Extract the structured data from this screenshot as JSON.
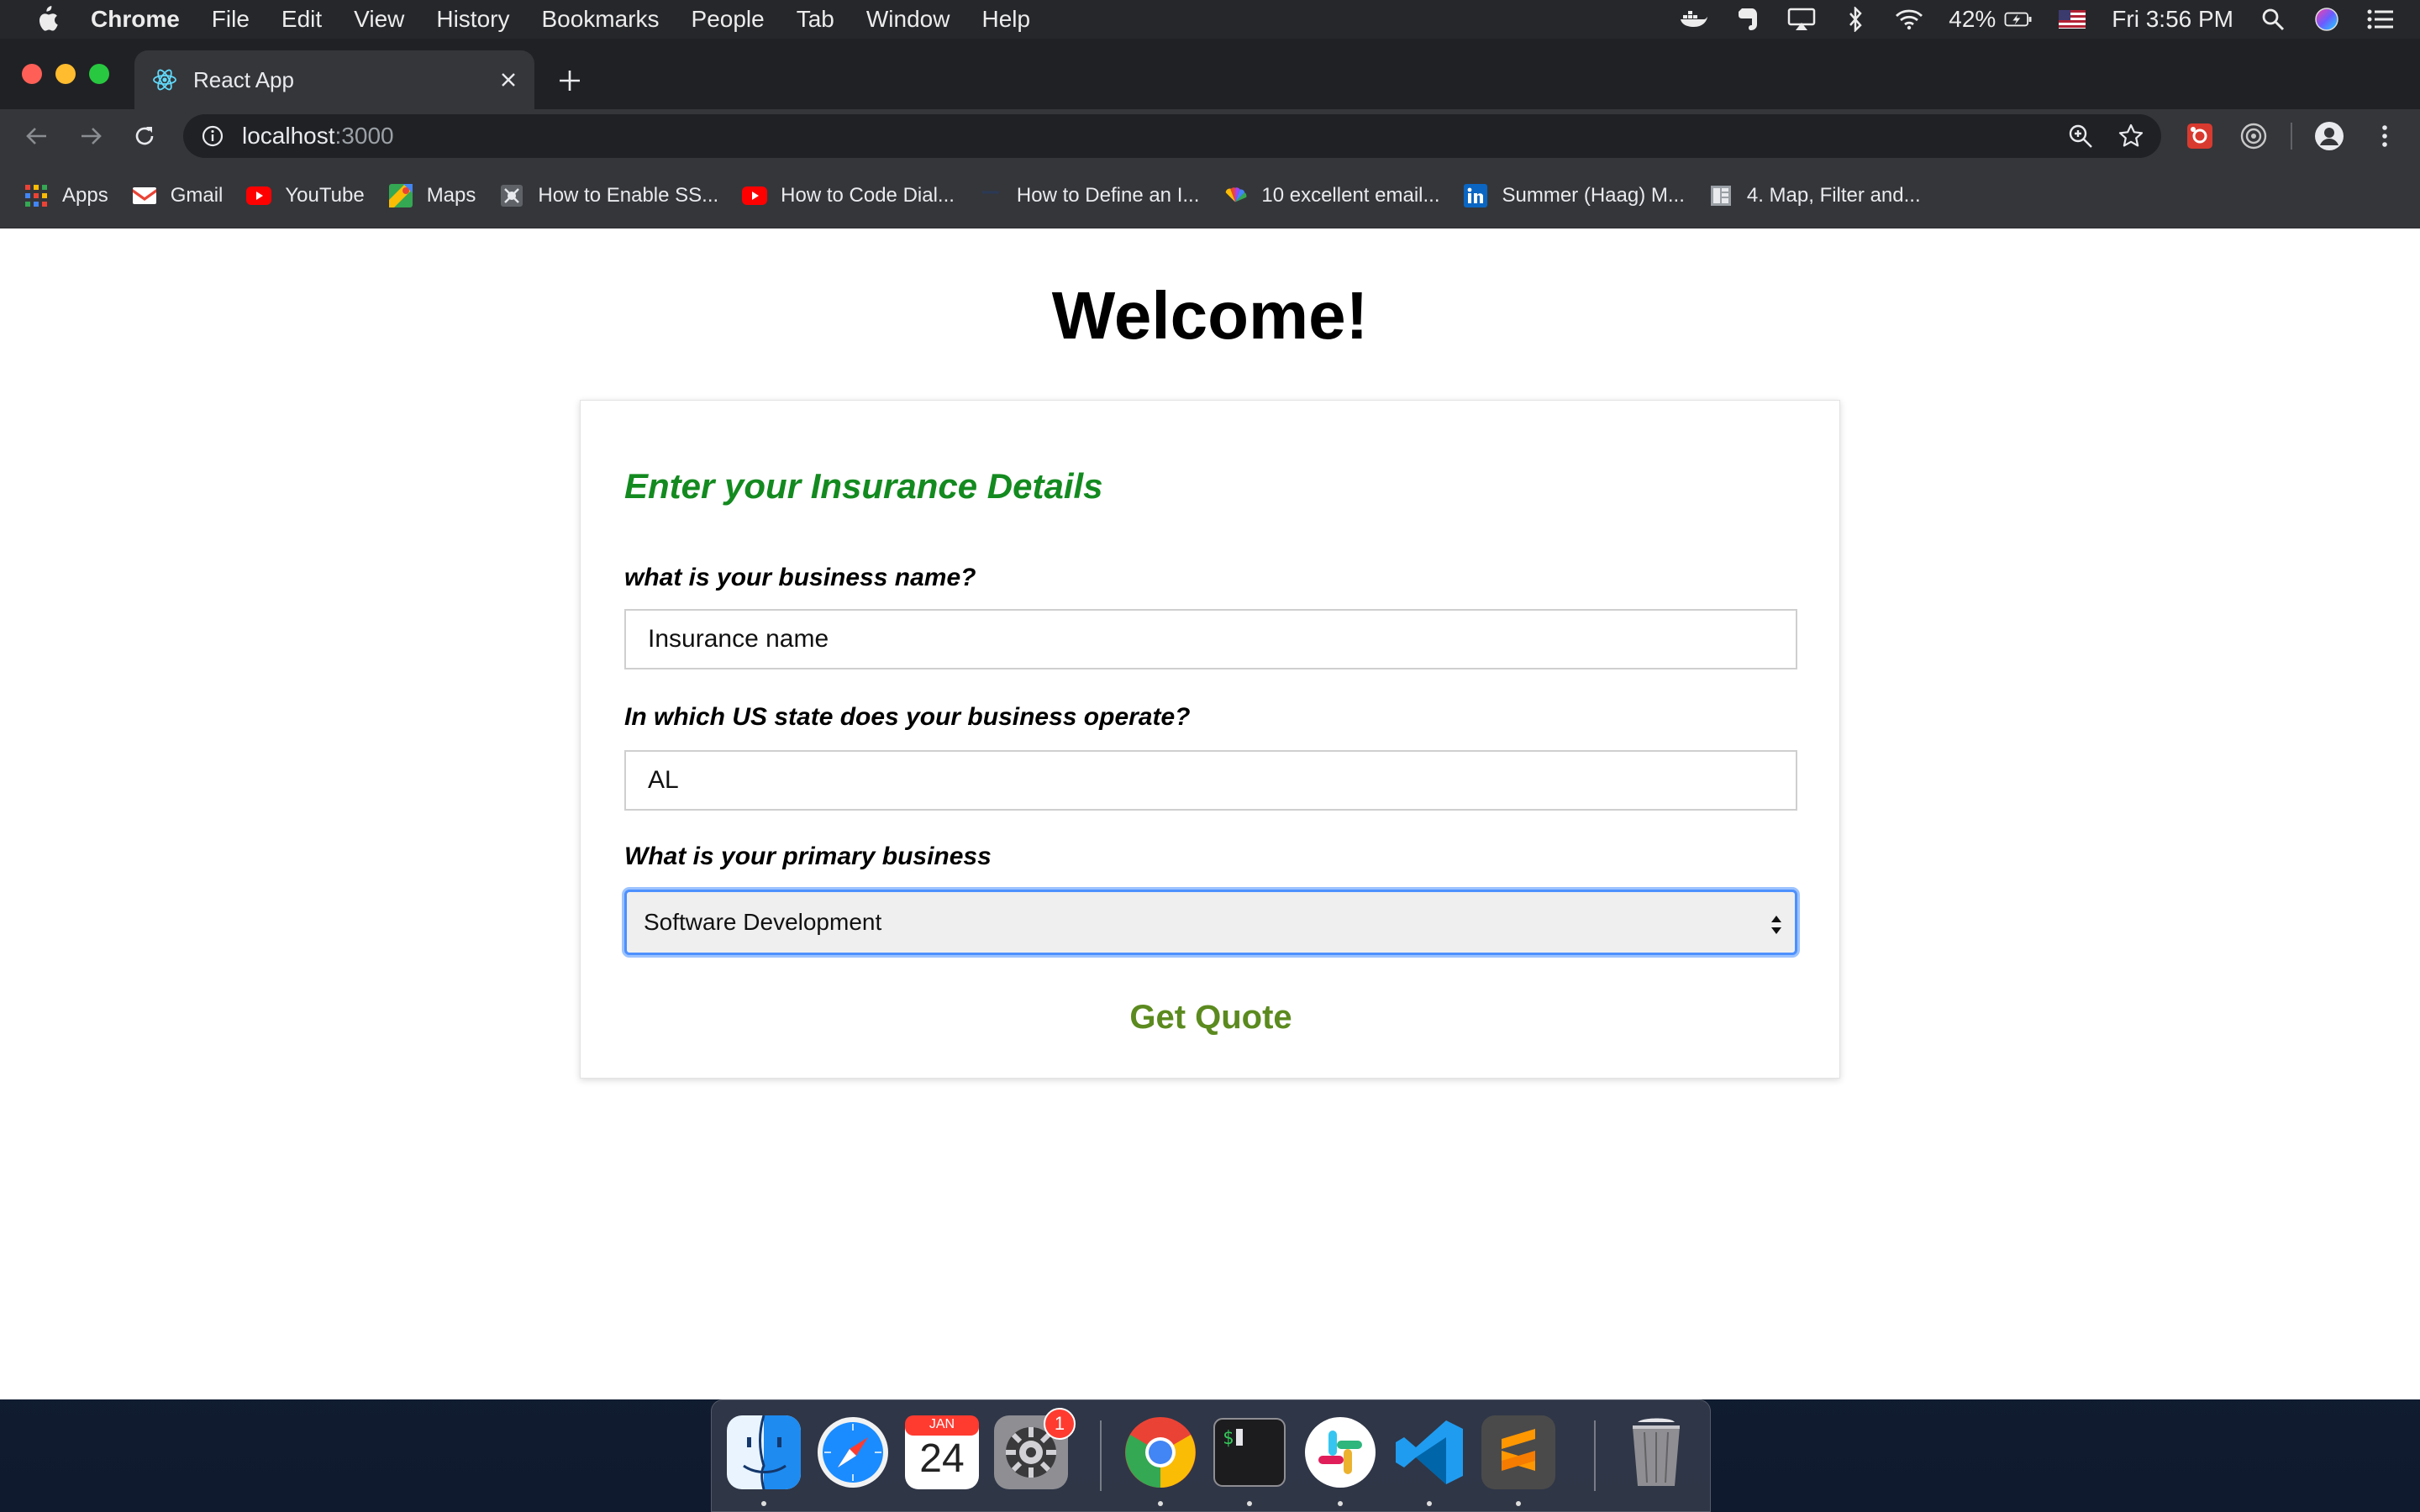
{
  "menubar": {
    "app": "Chrome",
    "items": [
      "File",
      "Edit",
      "View",
      "History",
      "Bookmarks",
      "People",
      "Tab",
      "Window",
      "Help"
    ],
    "battery": "42%",
    "clock": "Fri 3:56 PM",
    "icons": [
      "apple-icon",
      "docker-icon",
      "evernote-icon",
      "airplay-icon",
      "bluetooth-icon",
      "wifi-icon",
      "battery-icon",
      "us-flag-icon",
      "spotlight-icon",
      "siri-icon",
      "notification-center-icon"
    ]
  },
  "browser": {
    "tab_title": "React App",
    "url_host": "localhost",
    "url_port": ":3000",
    "bookmarks": [
      {
        "label": "Apps",
        "icon": "apps-grid-icon"
      },
      {
        "label": "Gmail",
        "icon": "gmail-icon"
      },
      {
        "label": "YouTube",
        "icon": "youtube-icon"
      },
      {
        "label": "Maps",
        "icon": "maps-icon"
      },
      {
        "label": "How to Enable SS...",
        "icon": "site-icon"
      },
      {
        "label": "How to Code Dial...",
        "icon": "youtube-icon"
      },
      {
        "label": "How to Define an I...",
        "icon": "site-icon"
      },
      {
        "label": "10 excellent email...",
        "icon": "nbc-icon"
      },
      {
        "label": "Summer (Haag) M...",
        "icon": "linkedin-icon"
      },
      {
        "label": "4. Map, Filter and...",
        "icon": "document-icon"
      }
    ]
  },
  "page": {
    "heading": "Welcome!",
    "form": {
      "title": "Enter your Insurance Details",
      "q1_label": "what is your business name?",
      "q1_value": "Insurance name",
      "q2_label": "In which US state does your business operate?",
      "q2_value": "AL",
      "q3_label": "What is your primary business",
      "q3_selected": "Software Development",
      "submit_label": "Get Quote"
    }
  },
  "dock": {
    "apps": [
      "Finder",
      "Safari",
      "Calendar",
      "System Preferences",
      "Google Chrome",
      "Terminal",
      "Slack",
      "Visual Studio Code",
      "Sublime Text",
      "Trash"
    ],
    "calendar_month": "JAN",
    "calendar_day": "24",
    "badge": "1"
  },
  "colors": {
    "form_title": "#138a1f",
    "submit": "#5b8a1f",
    "focus_ring": "#4d90fe"
  }
}
